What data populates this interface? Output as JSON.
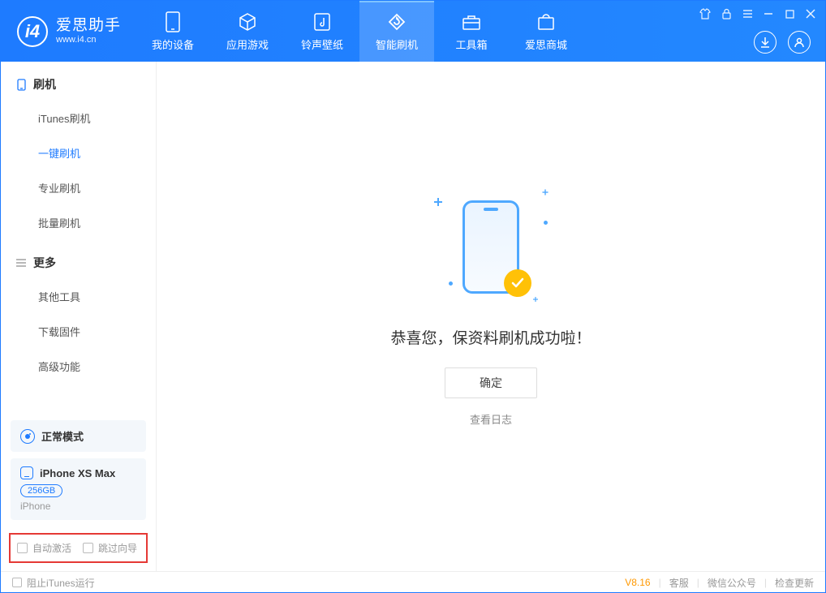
{
  "app": {
    "name_cn": "爱思助手",
    "name_en": "www.i4.cn"
  },
  "nav": [
    {
      "label": "我的设备",
      "icon": "device"
    },
    {
      "label": "应用游戏",
      "icon": "cube"
    },
    {
      "label": "铃声壁纸",
      "icon": "music"
    },
    {
      "label": "智能刷机",
      "icon": "refresh"
    },
    {
      "label": "工具箱",
      "icon": "toolbox"
    },
    {
      "label": "爱思商城",
      "icon": "store"
    }
  ],
  "nav_active_index": 3,
  "sidebar": {
    "sections": [
      {
        "title": "刷机",
        "icon": "phone",
        "items": [
          "iTunes刷机",
          "一键刷机",
          "专业刷机",
          "批量刷机"
        ],
        "selected_index": 1
      },
      {
        "title": "更多",
        "icon": "menu",
        "items": [
          "其他工具",
          "下载固件",
          "高级功能"
        ],
        "selected_index": -1
      }
    ]
  },
  "mode": {
    "label": "正常模式"
  },
  "device": {
    "name": "iPhone XS Max",
    "capacity": "256GB",
    "type": "iPhone"
  },
  "options": {
    "auto_activate_label": "自动激活",
    "skip_guide_label": "跳过向导"
  },
  "main": {
    "success_text": "恭喜您，保资料刷机成功啦！",
    "ok_button": "确定",
    "log_link": "查看日志"
  },
  "footer": {
    "block_itunes_label": "阻止iTunes运行",
    "version": "V8.16",
    "links": [
      "客服",
      "微信公众号",
      "检查更新"
    ]
  }
}
